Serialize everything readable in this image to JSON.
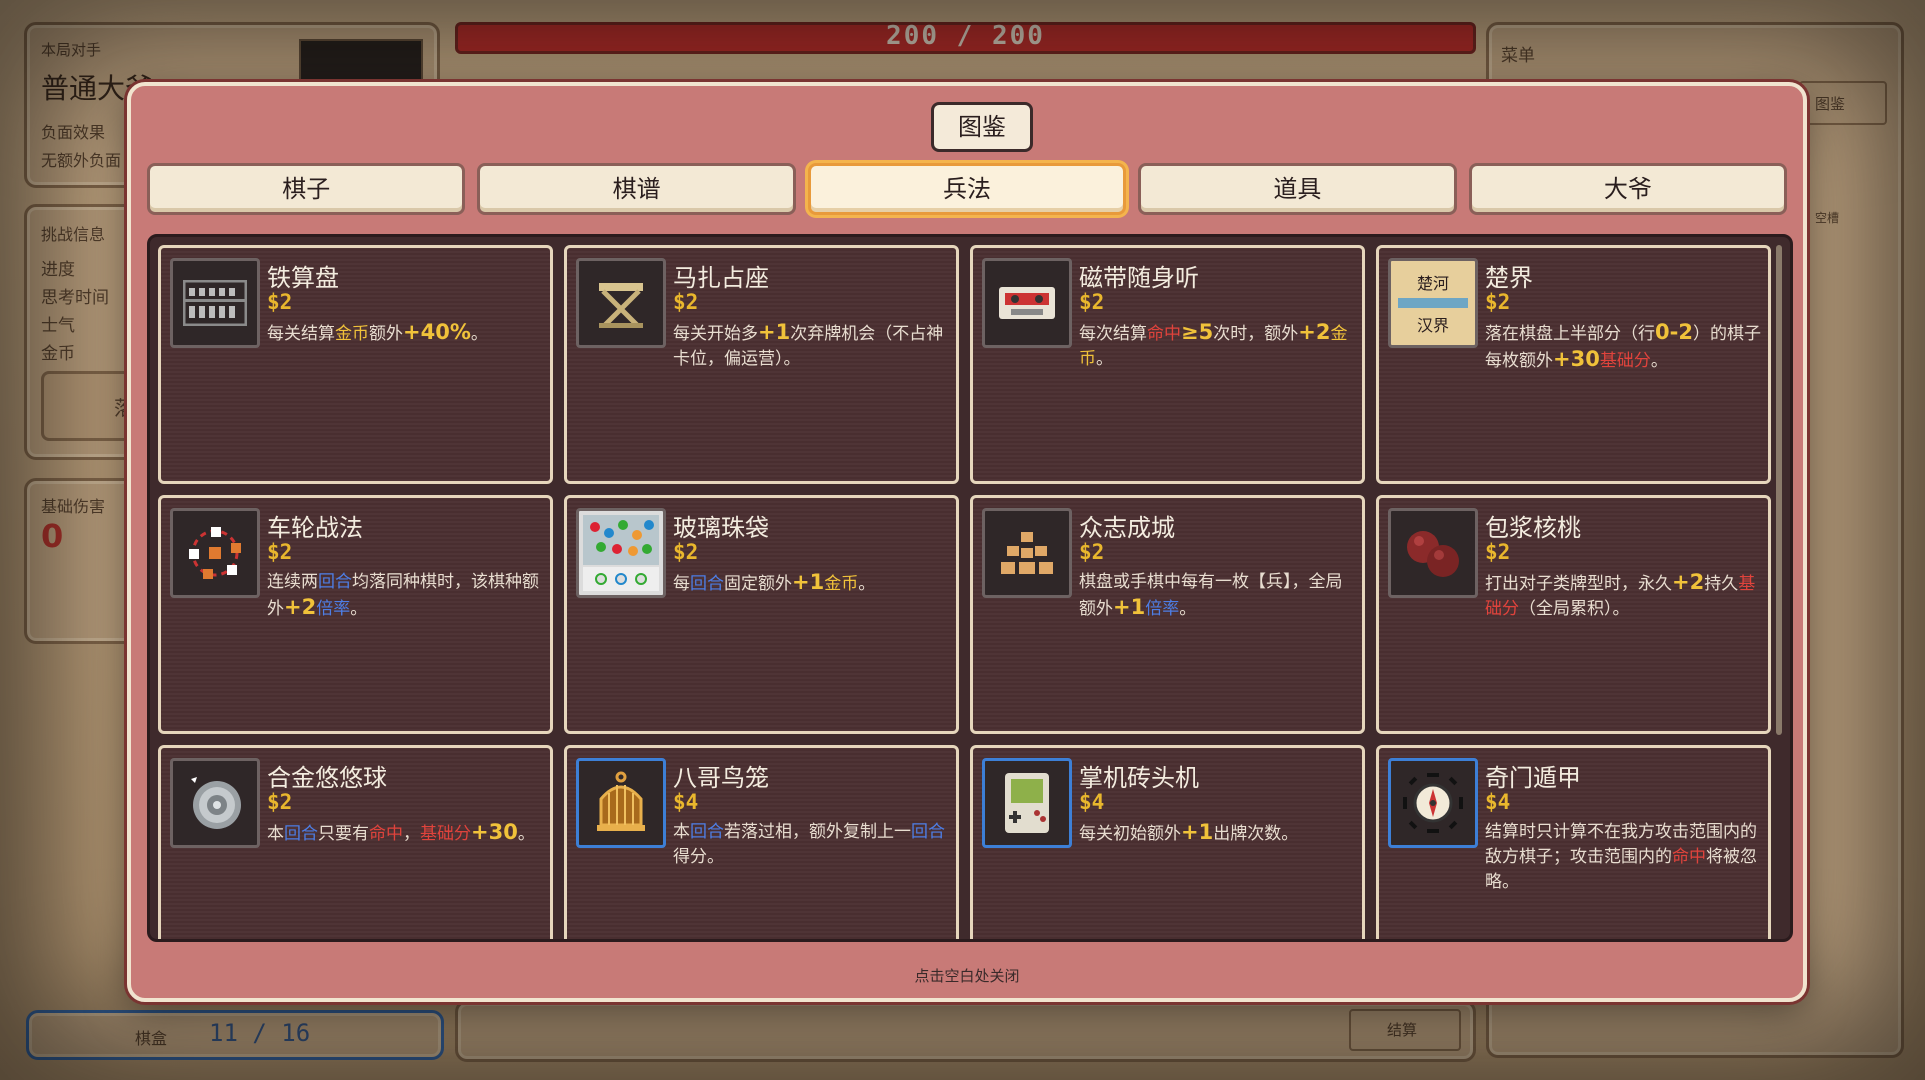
{
  "hp": {
    "current": "200",
    "sep": "/",
    "max": "200"
  },
  "left_panel": {
    "opponent_label": "本局对手",
    "opponent_name": "普通大爷",
    "negative_effect": "负面效果",
    "no_extra": "无额外负面",
    "challenge_info": "挑战信息",
    "progress": "进度",
    "think_time": "思考时间",
    "morale": "士气",
    "gold": "金币",
    "drop_btn": "落子",
    "base_damage_label": "基础伤害",
    "base_damage_value": "0",
    "box_label": "棋盒",
    "box_count": "11 / 16"
  },
  "right_panel": {
    "menu": "菜单",
    "handbook_btn": "图鉴",
    "empty": "空槽"
  },
  "bottom": {
    "settle_btn": "结算"
  },
  "modal": {
    "title": "图鉴",
    "tabs": [
      {
        "label": "棋子",
        "active": false
      },
      {
        "label": "棋谱",
        "active": false
      },
      {
        "label": "兵法",
        "active": true
      },
      {
        "label": "道具",
        "active": false
      },
      {
        "label": "大爷",
        "active": false
      }
    ],
    "close_hint": "点击空白处关闭",
    "cards": [
      {
        "name": "铁算盘",
        "price": "$2",
        "icon": "abacus-icon"
      },
      {
        "name": "马扎占座",
        "price": "$2",
        "icon": "folding-stool-icon"
      },
      {
        "name": "磁带随身听",
        "price": "$2",
        "icon": "cassette-icon"
      },
      {
        "name": "楚界",
        "price": "$2",
        "icon": "river-border-icon",
        "icon_text_top": "楚河",
        "icon_text_bottom": "汉界"
      },
      {
        "name": "车轮战法",
        "price": "$2",
        "icon": "wheel-pieces-icon"
      },
      {
        "name": "玻璃珠袋",
        "price": "$2",
        "icon": "marbles-icon"
      },
      {
        "name": "众志成城",
        "price": "$2",
        "icon": "crowd-icon"
      },
      {
        "name": "包浆核桃",
        "price": "$2",
        "icon": "walnuts-icon"
      },
      {
        "name": "合金悠悠球",
        "price": "$2",
        "icon": "yoyo-icon"
      },
      {
        "name": "八哥鸟笼",
        "price": "$4",
        "icon": "birdcage-icon"
      },
      {
        "name": "掌机砖头机",
        "price": "$4",
        "icon": "handheld-console-icon"
      },
      {
        "name": "奇门遁甲",
        "price": "$4",
        "icon": "bagua-compass-icon"
      }
    ],
    "desc": {
      "c0": [
        "每关结算",
        "金币",
        "额外",
        "+40%",
        "。"
      ],
      "c1": [
        "每关开始多",
        "+1",
        "次弃牌机会（不占神卡位，偏运营）。"
      ],
      "c2": [
        "每次结算",
        "命中",
        "≥5",
        "次时，额外",
        "+2",
        "金币",
        "。"
      ],
      "c3": [
        "落在棋盘上半部分（行",
        "0-2",
        "）的棋子每枚额外",
        "+30",
        "基础分",
        "。"
      ],
      "c4": [
        "连续两",
        "回合",
        "均落同种棋时，该棋种额外",
        "+2",
        "倍率",
        "。"
      ],
      "c5": [
        "每",
        "回合",
        "固定额外",
        "+1",
        "金币",
        "。"
      ],
      "c6": [
        "棋盘或手棋中每有一枚【兵】，全局额外",
        "+1",
        "倍率",
        "。"
      ],
      "c7": [
        "打出对子类牌型时，永久",
        "+2",
        "持久",
        "基础分",
        "（全局累积）。"
      ],
      "c8": [
        "本",
        "回合",
        "只要有",
        "命中",
        "，",
        "基础分",
        "+30",
        "。"
      ],
      "c9": [
        "本",
        "回合",
        "若落过相，额外复制上一",
        "回合",
        "得分。"
      ],
      "c10": [
        "每关初始额外",
        "+1",
        "出牌次数。"
      ],
      "c11": [
        "结算时只计算不在我方攻击范围内的敌方棋子；攻击范围内的",
        "命中",
        "将被忽略。"
      ]
    }
  },
  "colors": {
    "modal_bg": "#c87a77",
    "card_bg": "#4b2f31",
    "gold": "#f0c23a",
    "blue": "#4d7ee6",
    "red": "#e0433c",
    "active_tab": "#f4b44d"
  }
}
